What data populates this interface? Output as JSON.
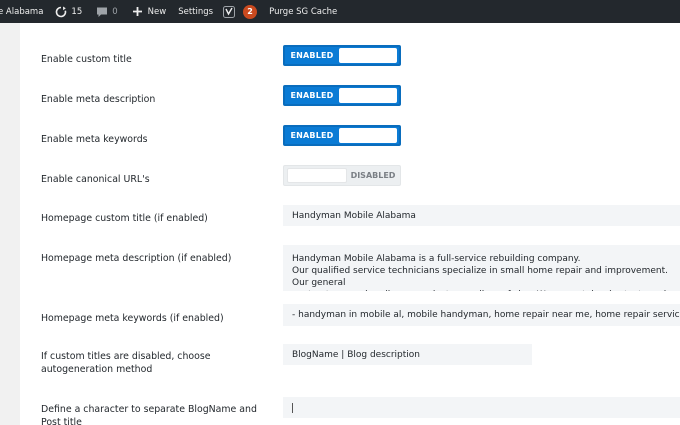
{
  "adminbar": {
    "site_name": "e Alabama",
    "updates_count": "15",
    "comments_count": "0",
    "new_label": "New",
    "settings_label": "Settings",
    "yoast_badge": "2",
    "purge_label": "Purge SG Cache"
  },
  "settings": {
    "custom_title": {
      "label": "Enable custom title",
      "state": "ENABLED"
    },
    "meta_description": {
      "label": "Enable meta description",
      "state": "ENABLED"
    },
    "meta_keywords": {
      "label": "Enable meta keywords",
      "state": "ENABLED"
    },
    "canonical": {
      "label": "Enable canonical URL's",
      "state": "DISABLED"
    },
    "homepage_title": {
      "label": "Homepage custom title (if enabled)",
      "value": "Handyman Mobile Alabama"
    },
    "homepage_description": {
      "label": "Homepage meta description (if enabled)",
      "value": "Handyman Mobile Alabama is a full-service rebuilding company.\nOur qualified service technicians specialize in small home repair and improvement. Our general\ncontractors can handle any project regardless of size. We never take shortcuts and always"
    },
    "homepage_keywords": {
      "label": "Homepage meta keywords (if enabled)",
      "value": " -  handyman in mobile al, mobile handyman, home repair near me, home repair services, h"
    },
    "autogeneration": {
      "label_line1": "If custom titles are disabled, choose",
      "label_line2": "autogeneration method",
      "value": "BlogName | Blog description"
    },
    "separator": {
      "label_line1": "Define a character to separate BlogName and",
      "label_line2": "Post title",
      "value": ""
    }
  }
}
